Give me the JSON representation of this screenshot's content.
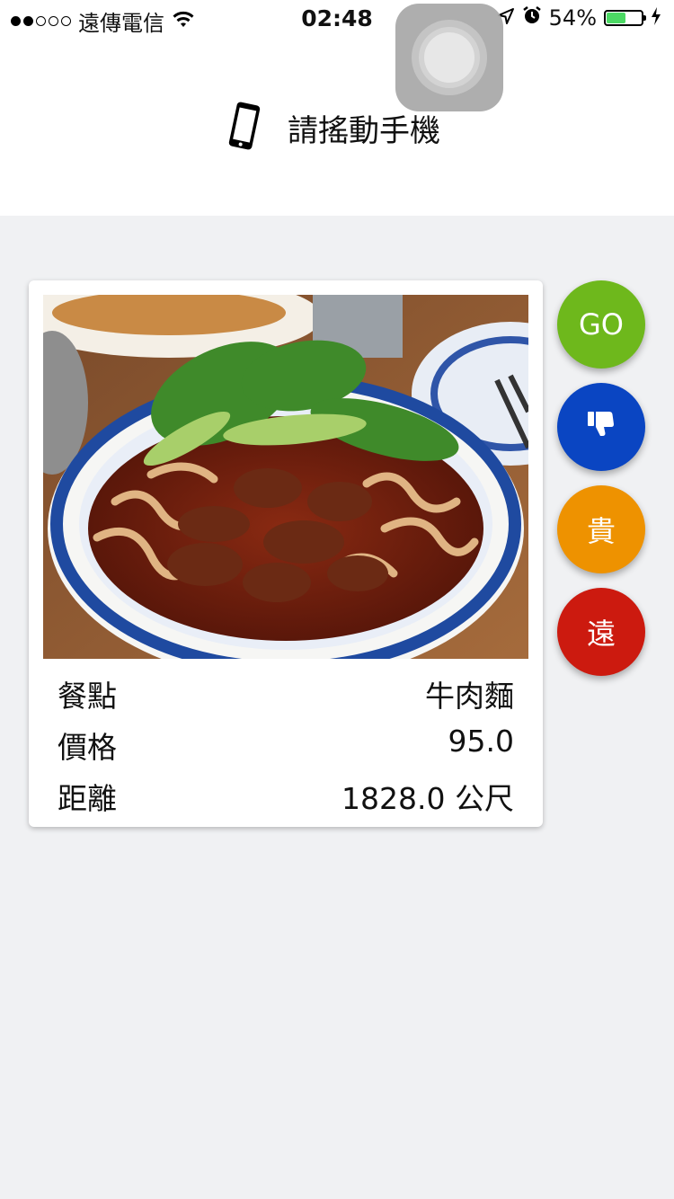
{
  "status_bar": {
    "carrier": "遠傳電信",
    "time": "02:48",
    "battery_percent_text": "54%",
    "battery_level": 0.54
  },
  "header": {
    "instruction": "請搖動手機"
  },
  "card": {
    "rows": [
      {
        "label": "餐點",
        "value": "牛肉麵"
      },
      {
        "label": "價格",
        "value": "95.0"
      },
      {
        "label": "距離",
        "value": "1828.0 公尺"
      }
    ]
  },
  "actions": {
    "go_label": "GO",
    "expensive_label": "貴",
    "far_label": "遠"
  },
  "colors": {
    "go": "#6eb81c",
    "dislike": "#0a45c2",
    "expensive": "#ee9200",
    "far": "#cc1a0f"
  }
}
